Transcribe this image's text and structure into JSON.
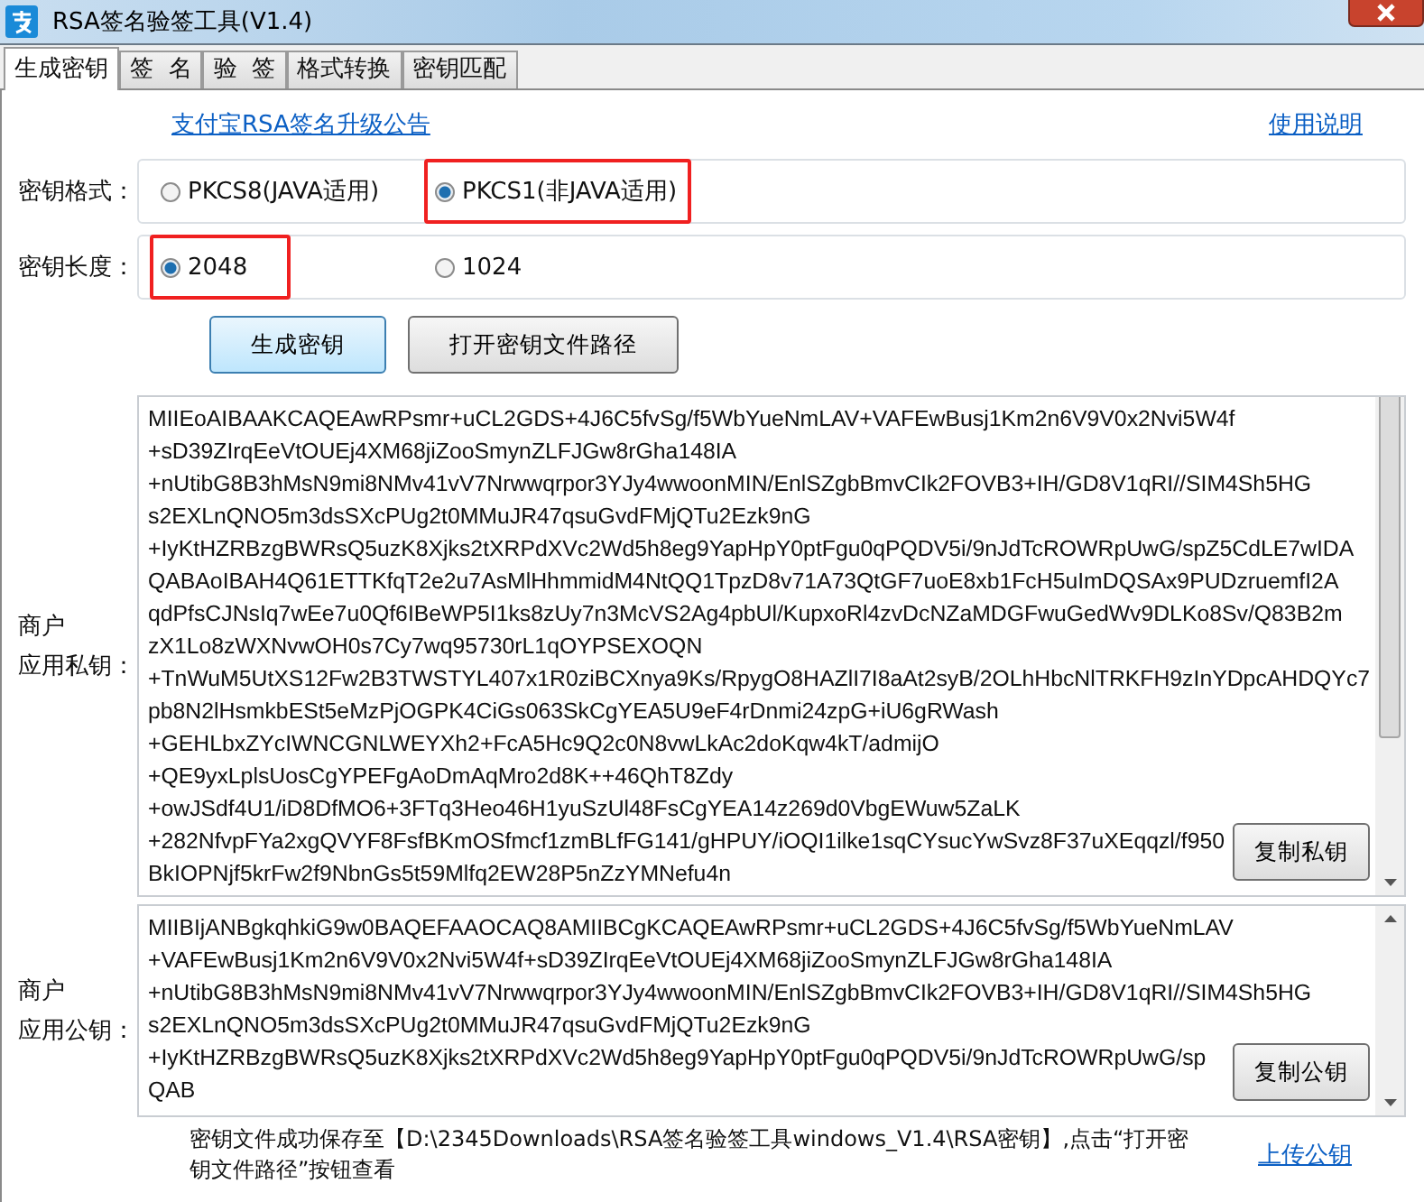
{
  "window": {
    "title": "RSA签名验签工具(V1.4)"
  },
  "tabs": [
    {
      "label": "生成密钥",
      "selected": true
    },
    {
      "label": "签  名",
      "selected": false
    },
    {
      "label": "验  签",
      "selected": false
    },
    {
      "label": "格式转换",
      "selected": false
    },
    {
      "label": "密钥匹配",
      "selected": false
    }
  ],
  "links": {
    "notice": "支付宝RSA签名升级公告",
    "help": "使用说明"
  },
  "key_format": {
    "label": "密钥格式：",
    "options": [
      {
        "label": "PKCS8(JAVA适用)",
        "selected": false,
        "highlighted": false
      },
      {
        "label": "PKCS1(非JAVA适用)",
        "selected": true,
        "highlighted": true
      }
    ]
  },
  "key_length": {
    "label": "密钥长度：",
    "options": [
      {
        "label": "2048",
        "selected": true,
        "highlighted": true
      },
      {
        "label": "1024",
        "selected": false,
        "highlighted": false
      }
    ]
  },
  "buttons": [
    {
      "label": "生成密钥",
      "default": true
    },
    {
      "label": "打开密钥文件路径",
      "default": false
    }
  ],
  "private_key": {
    "label_lines": [
      "商户",
      "应用私钥："
    ],
    "copy_button": "复制私钥",
    "lines": [
      "MIIEoAIBAAKCAQEAwRPsmr+uCL2GDS+4J6C5fvSg/f5WbYueNmLAV+VAFEwBusj1Km2n6V9V0x2Nvi5W4f",
      "+sD39ZIrqEeVtOUEj4XM68jiZooSmynZLFJGw8rGha148IA",
      "+nUtibG8B3hMsN9mi8NMv41vV7Nrwwqrpor3YJy4wwoonMIN/EnlSZgbBmvCIk2FOVB3+IH/GD8V1qRI//SIM4Sh5HG",
      "s2EXLnQNO5m3dsSXcPUg2t0MMuJR47qsuGvdFMjQTu2Ezk9nG",
      "+IyKtHZRBzgBWRsQ5uzK8Xjks2tXRPdXVc2Wd5h8eg9YapHpY0ptFgu0qPQDV5i/9nJdTcROWRpUwG/spZ5CdLE7wIDA",
      "QABAoIBAH4Q61ETTKfqT2e2u7AsMlHhmmidM4NtQQ1TpzD8v71A73QtGF7uoE8xb1FcH5uImDQSAx9PUDzruemfI2A",
      "qdPfsCJNsIq7wEe7u0Qf6IBeWP5I1ks8zUy7n3McVS2Ag4pbUl/KupxoRl4zvDcNZaMDGFwuGedWv9DLKo8Sv/Q83B2m",
      "zX1Lo8zWXNvwOH0s7Cy7wq95730rL1qOYPSEXOQN",
      "+TnWuM5UtXS12Fw2B3TWSTYL407x1R0ziBCXnya9Ks/RpygO8HAZlI7I8aAt2syB/2OLhHbcNlTRKFH9zInYDpcAHDQYc7",
      "pb8N2lHsmkbESt5eMzPjOGPK4CiGs063SkCgYEA5U9eF4rDnmi24zpG+iU6gRWash",
      "+GEHLbxZYcIWNCGNLWEYXh2+FcA5Hc9Q2c0N8vwLkAc2doKqw4kT/admijO",
      "+QE9yxLplsUosCgYPEFgAoDmAqMro2d8K++46QhT8Zdy",
      "+owJSdf4U1/iD8DfMO6+3FTq3Heo46H1yuSzUl48FsCgYEA14z269d0VbgEWuw5ZaLK",
      "+282NfvpFYa2xgQVYF8FsfBKmOSfmcf1zmBLfFG141/gHPUY/iOQI1ilke1sqCYsucYwSvz8F37uXEqqzl/f950",
      "BkIOPNjf5krFw2f9NbnGs5t59Mlfq2EW28P5nZzYMNefu4n"
    ]
  },
  "public_key": {
    "label_lines": [
      "商户",
      "应用公钥："
    ],
    "copy_button": "复制公钥",
    "lines": [
      "MIIBIjANBgkqhkiG9w0BAQEFAAOCAQ8AMIIBCgKCAQEAwRPsmr+uCL2GDS+4J6C5fvSg/f5WbYueNmLAV",
      "+VAFEwBusj1Km2n6V9V0x2Nvi5W4f+sD39ZIrqEeVtOUEj4XM68jiZooSmynZLFJGw8rGha148IA",
      "+nUtibG8B3hMsN9mi8NMv41vV7Nrwwqrpor3YJy4wwoonMIN/EnlSZgbBmvCIk2FOVB3+IH/GD8V1qRI//SIM4Sh5HG",
      "s2EXLnQNO5m3dsSXcPUg2t0MMuJR47qsuGvdFMjQTu2Ezk9nG",
      "+IyKtHZRBzgBWRsQ5uzK8Xjks2tXRPdXVc2Wd5h8eg9YapHpY0ptFgu0qPQDV5i/9nJdTcROWRpUwG/sp",
      "QAB"
    ]
  },
  "status_message": "密钥文件成功保存至【D:\\2345Downloads\\RSA签名验签工具windows_V1.4\\RSA密钥】,点击“打开密钥文件路径”按钮查看",
  "upload_link": "上传公钥"
}
